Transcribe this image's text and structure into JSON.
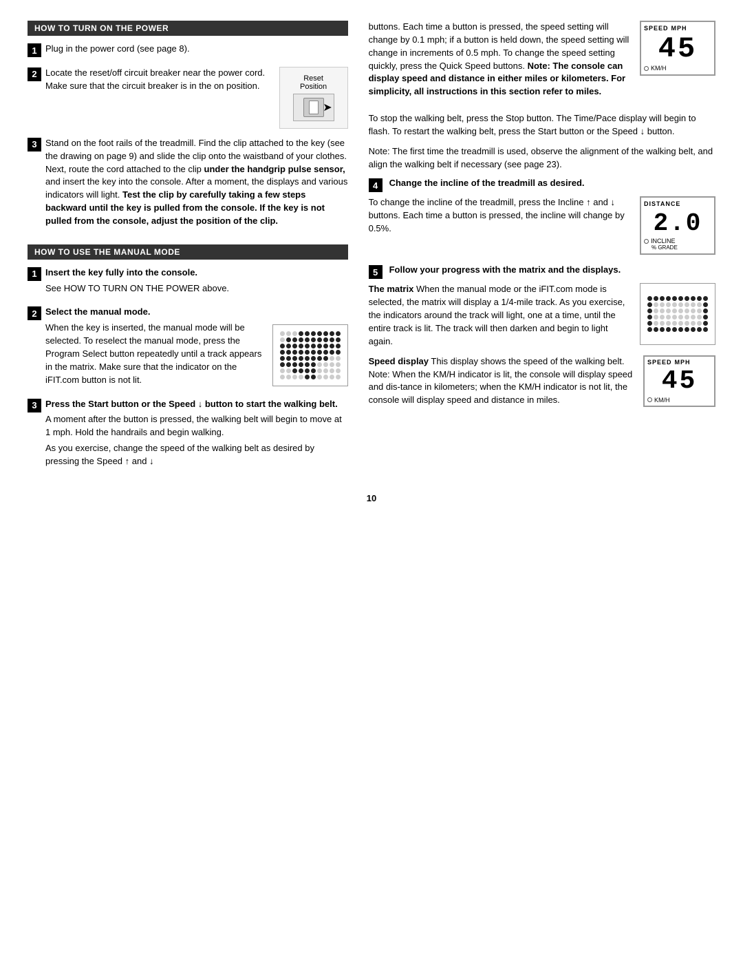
{
  "page": {
    "number": "10",
    "left": {
      "section1": {
        "header": "HOW TO TURN ON THE POWER",
        "steps": [
          {
            "num": "1",
            "text": "Plug in the power cord (see page 8)."
          },
          {
            "num": "2",
            "text_before": "Locate the reset/off circuit breaker near the power cord. Make sure that the circuit breaker is in the on position.",
            "image_label": "Reset\nPosition"
          },
          {
            "num": "3",
            "text": "Stand on the foot rails of the treadmill. Find the clip attached to the key (see the drawing on page 9) and slide the clip onto the waistband of your clothes. Next, route the cord attached to the clip ",
            "bold_text": "under the handgrip pulse sensor,",
            "text2": " and insert the key into the console. After a moment, the displays and various indicators will light. ",
            "bold_text2": "Test the clip by carefully taking a few steps backward until the key is pulled from the console. If the key is not pulled from the console, adjust the position of the clip."
          }
        ]
      },
      "section2": {
        "header": "HOW TO USE THE MANUAL MODE",
        "steps": [
          {
            "num": "1",
            "heading": "Insert the key fully into the console.",
            "text": "See HOW TO TURN ON THE POWER above."
          },
          {
            "num": "2",
            "heading": "Select the manual mode.",
            "text": "When the key is inserted, the manual mode will be selected. To reselect the manual mode, press the Program Select button repeatedly until a track appears in the matrix. Make sure that the indicator on the iFIT.com button is not lit."
          },
          {
            "num": "3",
            "bold_text": "Press the Start button or the Speed ↓ button to start the walking belt.",
            "text": "A moment after the button is pressed, the walking belt will begin to move at 1 mph. Hold the handrails and begin walking.",
            "text2": "As you exercise, change the speed of the walking belt as desired by pressing the Speed ↑ and ↓"
          }
        ]
      }
    },
    "right": {
      "intro_text": "buttons. Each time a button is pressed, the speed setting will change by 0.1 mph; if a button is held down, the speed setting will change in increments of 0.5 mph. To change the speed setting quickly, press the Quick Speed buttons. ",
      "bold_note": "Note: The console can display speed and distance in either miles or kilometers. For simplicity, all instructions in this section refer to miles.",
      "stop_text": "To stop the walking belt, press the Stop button. The Time/Pace display will begin to flash. To restart the walking belt, press the Start button or the Speed ↓ button.",
      "note_text": "Note: The first time the treadmill is used, observe the alignment of the walking belt, and align the walking belt if necessary (see page 23).",
      "step4": {
        "num": "4",
        "heading": "Change the incline of the treadmill as desired.",
        "text": "To change the incline of the treadmill, press the Incline ↑ and ↓ buttons. Each time a button is pressed, the incline will change by 0.5%."
      },
      "step5": {
        "num": "5",
        "heading": "Follow your progress with the matrix and the displays.",
        "matrix_text_bold": "The matrix",
        "matrix_text": " When the manual mode or the iFIT.com mode is selected, the matrix will display a 1/4-mile track. As you exercise, the indicators around the track will light, one at a time, until the entire track is lit. The track will then darken and begin to light again.",
        "speed_display_label": "Speed display",
        "speed_display_text": " This display shows the speed of the walking belt. Note: When the KM/H indicator is lit, the console will display speed and dis-tance in kilometers; when the KM/H indicator is not lit, the console will display speed and distance in miles."
      },
      "speed_display": {
        "top_left": "SPEED",
        "top_right": "MPH",
        "number": "45",
        "bottom": "KM/H"
      },
      "incline_display": {
        "top": "DISTANCE",
        "number": "20",
        "bottom_label": "INCLINE",
        "bottom_sub": "% GRADE"
      }
    }
  }
}
